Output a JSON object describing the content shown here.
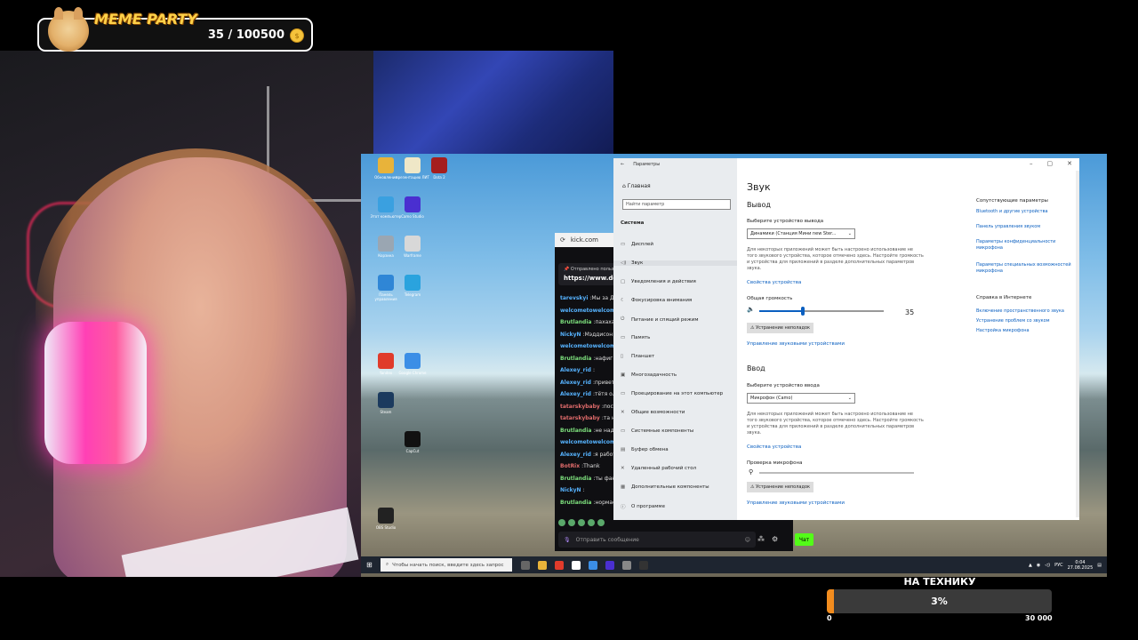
{
  "overlay": {
    "meme_title": "MEME PARTY",
    "meme_count": "35 / 100500",
    "coin_glyph": "$",
    "goal_title": "НА ТЕХНИКУ",
    "goal_percent": "3%",
    "goal_fraction": 0.03,
    "goal_min": "0",
    "goal_max": "30 000",
    "colors": {
      "goal_fill": "#f28c1e",
      "meme_title": "#ffd24a"
    }
  },
  "desktop": {
    "icons": [
      {
        "label": "Обновления",
        "color": "#e8b33a"
      },
      {
        "label": "презентацию ЛИТ",
        "color": "#efe7c7"
      },
      {
        "label": "Dota 2",
        "color": "#a51e1e"
      },
      {
        "label": "Этот компьютер",
        "color": "#3aa0e0"
      },
      {
        "label": "Camo Studio",
        "color": "#4a2fd0"
      },
      {
        "label": "Корзина",
        "color": "#9aa6b2"
      },
      {
        "label": "Warframe",
        "color": "#d8d8d8"
      },
      {
        "label": "Панель управления",
        "color": "#2f86d6"
      },
      {
        "label": "Telegram",
        "color": "#2aa3de"
      },
      {
        "label": "Yandex",
        "color": "#e03b2b"
      },
      {
        "label": "Google Chrome",
        "color": "#3b8ee6"
      },
      {
        "label": "Steam",
        "color": "#1b3a5e"
      },
      {
        "label": "CapCut",
        "color": "#111"
      },
      {
        "label": "OBS Studio",
        "color": "#222"
      }
    ]
  },
  "chat": {
    "url": "kick.com",
    "pinned_text": "Отправлено пользователем",
    "pinned_link": "https://www.donati",
    "lines": [
      {
        "user": "tarevskyi",
        "text": "Мы за Дина",
        "color": "#56b3ff"
      },
      {
        "user": "welcometowelcome",
        "text": "",
        "color": "#56b3ff"
      },
      {
        "user": "Brutlandia",
        "text": "пахахах",
        "color": "#7de07d"
      },
      {
        "user": "NickyN",
        "text": "Мэддисон з",
        "color": "#56b3ff"
      },
      {
        "user": "welcometowelcome",
        "text": "",
        "color": "#56b3ff"
      },
      {
        "user": "Brutlandia",
        "text": "нафиг эти",
        "color": "#7de07d"
      },
      {
        "user": "Alexey_rid",
        "text": "",
        "color": "#56b3ff"
      },
      {
        "user": "Alexey_rid",
        "text": "привету",
        "color": "#56b3ff"
      },
      {
        "user": "Alexey_rid",
        "text": "тётя оля",
        "color": "#56b3ff"
      },
      {
        "user": "tatarskybaby",
        "text": "постав",
        "color": "#e06b6b"
      },
      {
        "user": "tatarskybaby",
        "text": "та нори",
        "color": "#e06b6b"
      },
      {
        "user": "Brutlandia",
        "text": "не надо Ц",
        "color": "#7de07d"
      },
      {
        "user": "welcometowelcome",
        "text": "",
        "color": "#56b3ff"
      },
      {
        "user": "Alexey_rid",
        "text": "я работаю",
        "color": "#56b3ff"
      },
      {
        "user": "BotRix",
        "text": "Thank",
        "color": "#e06b6b"
      },
      {
        "user": "Brutlandia",
        "text": "ты фанат",
        "color": "#7de07d"
      },
      {
        "user": "NickyN",
        "text": "",
        "color": "#56b3ff"
      },
      {
        "user": "Brutlandia",
        "text": "нормас ж",
        "color": "#7de07d"
      }
    ],
    "input_placeholder": "Отправить сообщение",
    "send_label": "Чат"
  },
  "settings": {
    "window_title": "Параметры",
    "home": "Главная",
    "search_placeholder": "Найти параметр",
    "section": "Система",
    "nav": [
      {
        "label": "Дисплей",
        "icon": "▭"
      },
      {
        "label": "Звук",
        "icon": "◁)"
      },
      {
        "label": "Уведомления и действия",
        "icon": "▢"
      },
      {
        "label": "Фокусировка внимания",
        "icon": "☾"
      },
      {
        "label": "Питание и спящий режим",
        "icon": "⏻"
      },
      {
        "label": "Память",
        "icon": "▭"
      },
      {
        "label": "Планшет",
        "icon": "▯"
      },
      {
        "label": "Многозадачность",
        "icon": "▣"
      },
      {
        "label": "Проецирование на этот компьютер",
        "icon": "▭"
      },
      {
        "label": "Общие возможности",
        "icon": "✕"
      },
      {
        "label": "Системные компоненты",
        "icon": "▭"
      },
      {
        "label": "Буфер обмена",
        "icon": "▤"
      },
      {
        "label": "Удаленный рабочий стол",
        "icon": "✕"
      },
      {
        "label": "Дополнительные компоненты",
        "icon": "▦"
      },
      {
        "label": "О программе",
        "icon": "ⓘ"
      }
    ],
    "page_title": "Звук",
    "output_title": "Вывод",
    "output_device_label": "Выберите устройство вывода",
    "output_device": "Динамики (Станция Мини new Ster...",
    "output_note": "Для некоторых приложений может быть настроено использование не того звукового устройства, которое отмечено здесь. Настройте громкость и устройства для приложений в разделе дополнительных параметров звука.",
    "device_props": "Свойства устройства",
    "volume_label": "Общая громкость",
    "volume_value": "35",
    "volume_fraction": 0.35,
    "troubleshoot": "Устранение неполадок",
    "manage_devices": "Управление звуковыми устройствами",
    "input_title": "Ввод",
    "input_device_label": "Выберите устройство ввода",
    "input_device": "Микрофон (Camo)",
    "input_note": "Для некоторых приложений может быть настроено использование не того звукового устройства, которое отмечено здесь. Настройте громкость и устройства для приложений в разделе дополнительных параметров звука.",
    "input_device_props": "Свойства устройства",
    "mic_test_label": "Проверка микрофона",
    "input_troubleshoot": "Устранение неполадок",
    "input_manage_devices": "Управление звуковыми устройствами",
    "related_title": "Сопутствующие параметры",
    "related_links": [
      "Bluetooth и другие устройства",
      "Панель управления звуком",
      "Параметры конфиденциальности микрофона",
      "Параметры специальных возможностей микрофона"
    ],
    "help_title": "Справка в Интернете",
    "help_links": [
      "Включение пространственного звука",
      "Устранение проблем со звуком",
      "Настройка микрофона"
    ]
  },
  "taskbar": {
    "search_placeholder": "Чтобы начать поиск, введите здесь запрос",
    "lang": "РУС",
    "time": "0:04",
    "date": "27.08.2025"
  }
}
